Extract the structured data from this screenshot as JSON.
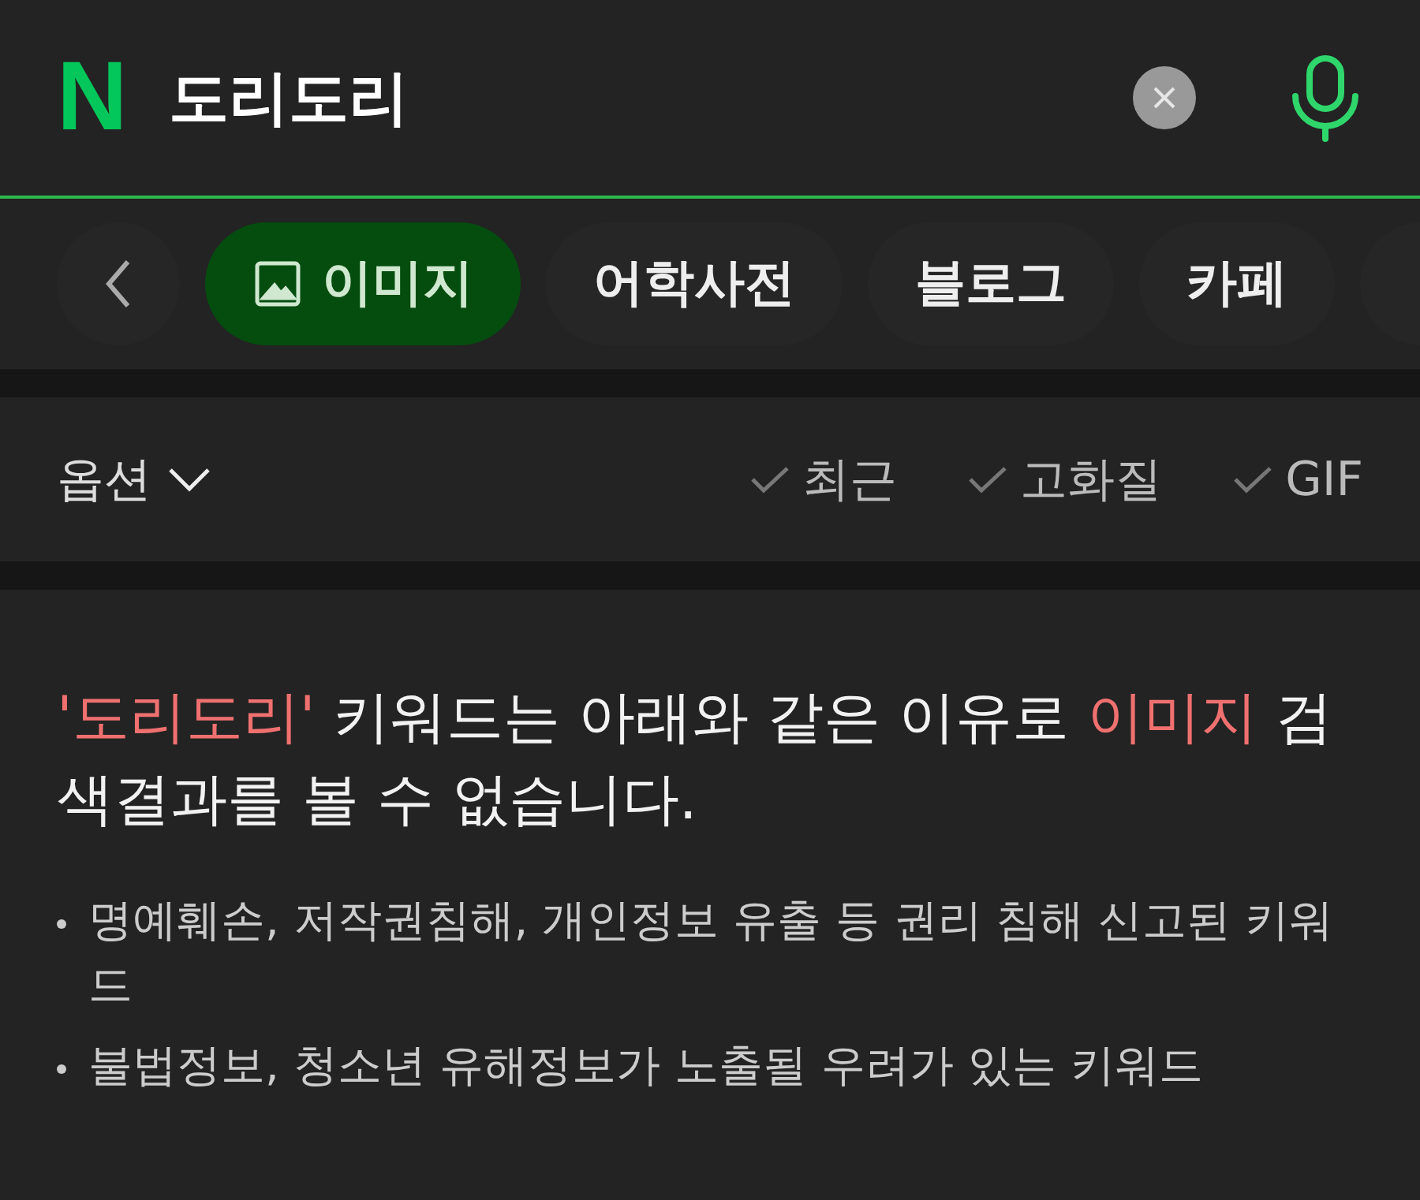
{
  "search": {
    "logo": "N",
    "value": "도리도리"
  },
  "tabs": [
    {
      "label": "이미지",
      "selected": true,
      "kind": "image"
    },
    {
      "label": "어학사전",
      "selected": false
    },
    {
      "label": "블로그",
      "selected": false
    },
    {
      "label": "카페",
      "selected": false
    }
  ],
  "options": {
    "label": "옵션",
    "expanded": false,
    "filters": [
      {
        "label": "최근",
        "checked": false
      },
      {
        "label": "고화질",
        "checked": false
      },
      {
        "label": "GIF",
        "checked": false
      }
    ]
  },
  "notice": {
    "message": [
      {
        "text": "'도리도리'",
        "highlight": true
      },
      {
        "text": " 키워드는 아래와 같은 이유로 ",
        "highlight": false
      },
      {
        "text": "이미지",
        "highlight": true
      },
      {
        "text": " 검색결과를 볼 수 없습니다.",
        "highlight": false
      }
    ],
    "reasons": [
      "명예훼손, 저작권침해, 개인정보 유출 등 권리 침해 신고된 키워드",
      "불법정보, 청소년 유해정보가 노출될 우려가 있는 키워드"
    ]
  }
}
